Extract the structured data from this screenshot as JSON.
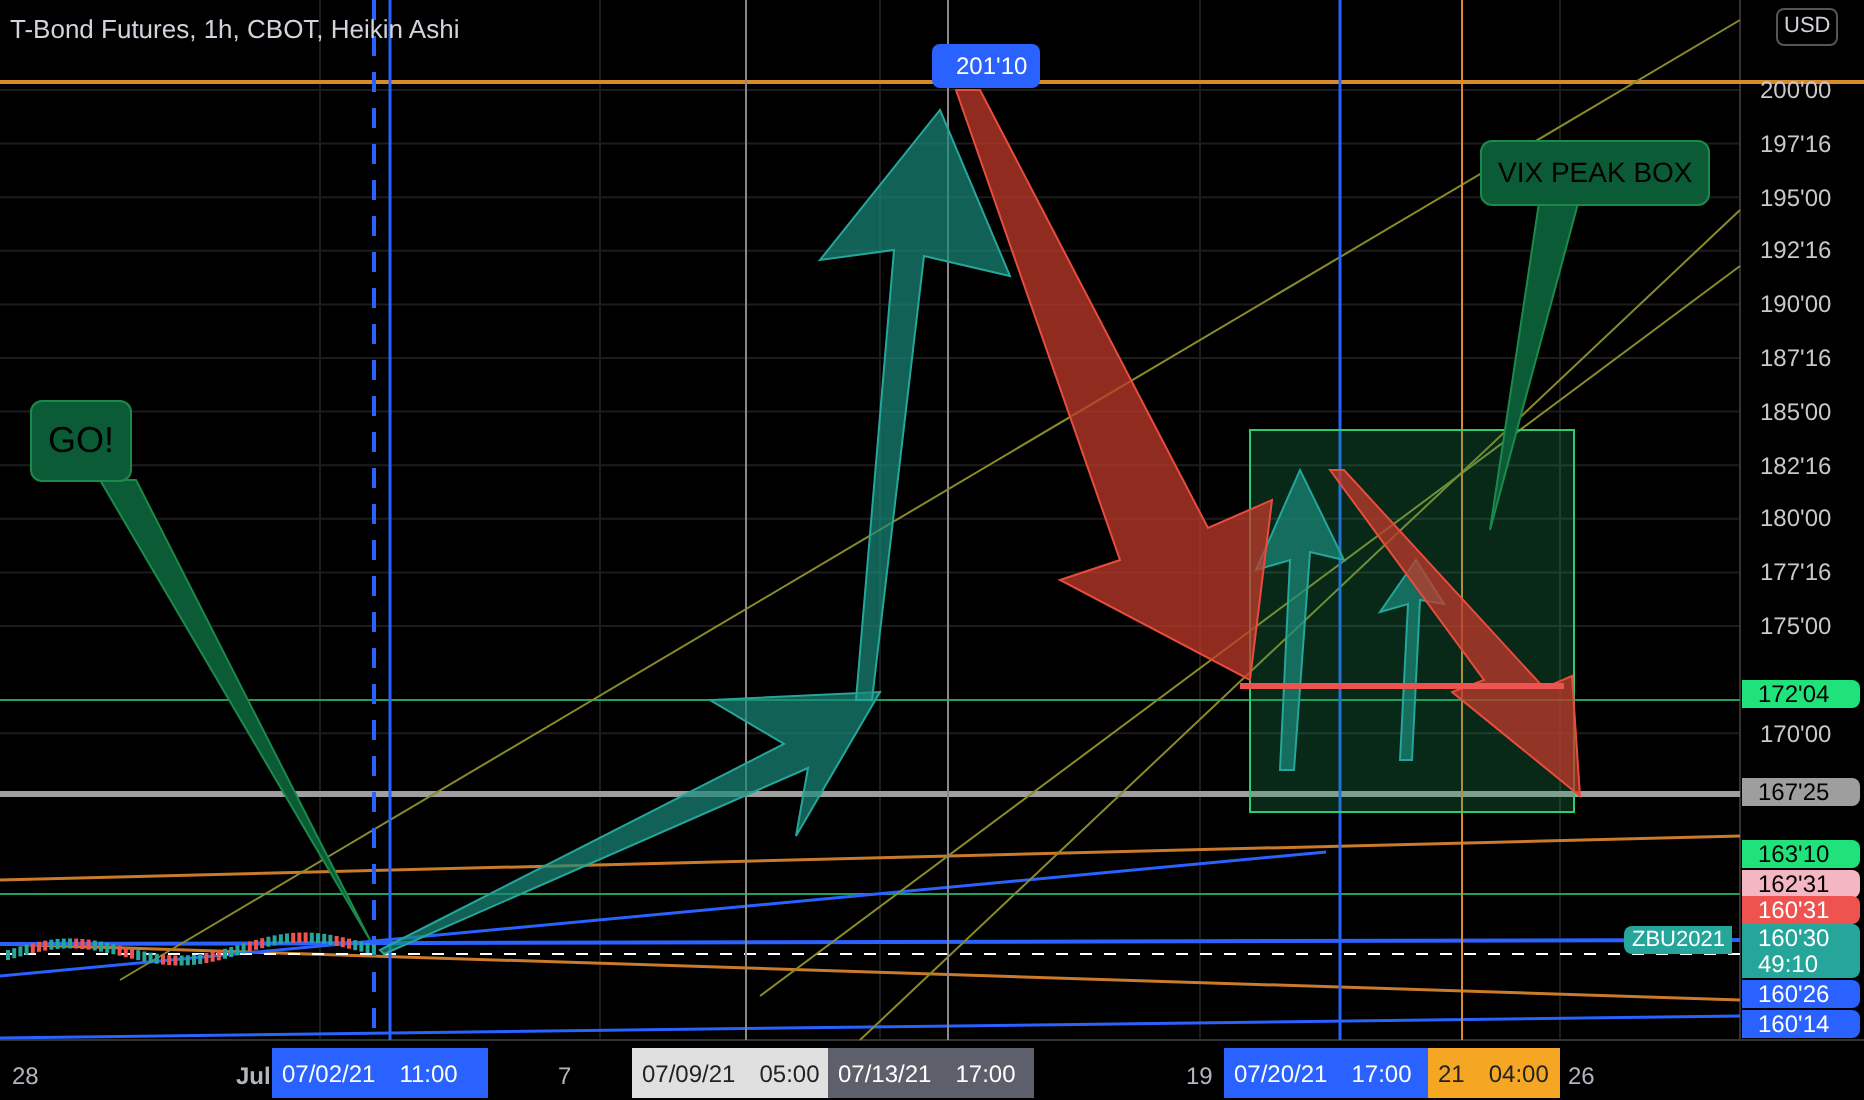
{
  "chart_title": "T-Bond Futures, 1h, CBOT, Heikin Ashi",
  "price_axis": {
    "currency": "USD",
    "ticks": [
      "200'00",
      "197'16",
      "195'00",
      "192'16",
      "190'00",
      "187'16",
      "185'00",
      "182'16",
      "180'00",
      "177'16",
      "175'00",
      "170'00"
    ]
  },
  "price_labels": [
    {
      "text": "172'04",
      "color": "#1fe27a"
    },
    {
      "text": "167'25",
      "color": "#9e9e9e"
    },
    {
      "text": "163'10",
      "color": "#1fe27a"
    },
    {
      "text": "162'31",
      "color": "#f4b6c2"
    },
    {
      "text": "160'31",
      "color": "#ef5350"
    },
    {
      "text": "160'30",
      "sub": "49:10",
      "color": "#26a69a"
    },
    {
      "text": "160'26",
      "color": "#2962ff"
    },
    {
      "text": "160'14",
      "color": "#2962ff"
    }
  ],
  "time_axis": {
    "labels": [
      {
        "text": "28",
        "bold": false
      },
      {
        "text": "Jul",
        "bold": true
      },
      {
        "text": "7",
        "bold": false
      },
      {
        "text": "19",
        "bold": false
      },
      {
        "text": "26",
        "bold": false
      }
    ],
    "markers": [
      {
        "date": "07/02/21",
        "time": "11:00",
        "color": "#2962ff"
      },
      {
        "date": "07/09/21",
        "time": "05:00",
        "color": "#e0e0e0"
      },
      {
        "date": "07/13/21",
        "time": "17:00",
        "color": "#5d606b"
      },
      {
        "date": "07/20/21",
        "time": "17:00",
        "color": "#2962ff"
      },
      {
        "date": "21",
        "time": "04:00",
        "color": "#f5a623"
      }
    ]
  },
  "annotations": [
    {
      "kind": "callout",
      "text": "GO!"
    },
    {
      "kind": "callout",
      "text": "VIX PEAK BOX"
    },
    {
      "kind": "price_tag",
      "text": "201'10"
    },
    {
      "kind": "symbol_tag",
      "text": "ZBU2021"
    }
  ]
}
